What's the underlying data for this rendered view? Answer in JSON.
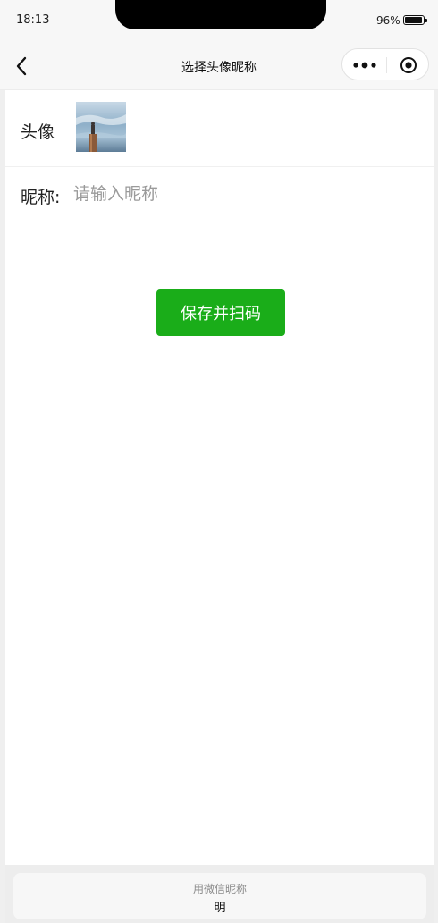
{
  "status_bar": {
    "time": "18:13",
    "battery": "96%"
  },
  "nav": {
    "title": "选择头像昵称"
  },
  "form": {
    "avatar_label": "头像",
    "nickname_label": "昵称:",
    "nickname_placeholder": "请输入昵称",
    "save_button": "保存并扫码"
  },
  "suggestion_sheet": {
    "title": "用微信昵称",
    "value": "明"
  },
  "colors": {
    "primary": "#1aad19",
    "nav_bg": "#f7f7f7"
  },
  "icons": [
    "back-arrow-icon",
    "more-dots-icon",
    "close-circle-icon",
    "battery-icon"
  ]
}
